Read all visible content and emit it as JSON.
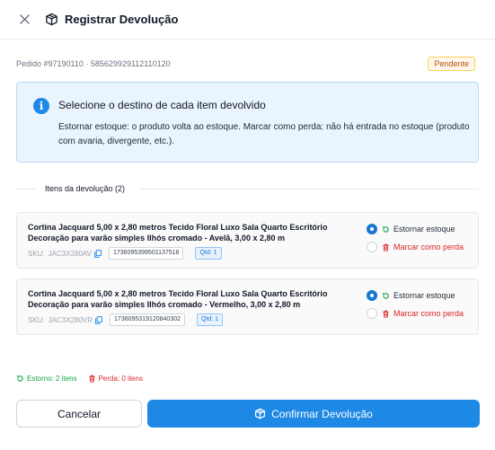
{
  "dialog": {
    "title": "Registrar Devolução",
    "order_label": "Pedido #97190110 · 585629929112110120",
    "status": "Pendente"
  },
  "info": {
    "title": "Selecione o destino de cada item devolvido",
    "text": "Estornar estoque: o produto volta ao estoque. Marcar como perda: não há entrada no estoque (produto com avaria, divergente, etc.)."
  },
  "items_section": {
    "title": "Itens da devolução (2)"
  },
  "items": [
    {
      "name": "Cortina Jacquard 5,00 x 2,80 metros Tecido Floral Luxo Sala Quarto Escritório Decoração para varão simples Ilhós cromado - Avelã, 3,00 x 2,80 m",
      "sku_label": "SKU:",
      "sku": "JAC3X280AV",
      "ean": "1736095399501137518",
      "qty": "Qtd: 1",
      "restock_label": "Estornar estoque",
      "loss_label": "Marcar como perda",
      "selected": "restock"
    },
    {
      "name": "Cortina Jacquard 5,00 x 2,80 metros Tecido Floral Luxo Sala Quarto Escritório Decoração para varão simples Ilhós cromado - Vermelho, 3,00 x 2,80 m",
      "sku_label": "SKU:",
      "sku": "JAC3X280VR",
      "ean": "1736095319120840302",
      "qty": "Qtd: 1",
      "restock_label": "Estornar estoque",
      "loss_label": "Marcar como perda",
      "selected": "restock"
    }
  ],
  "summary": {
    "restock": "Estorno: 2 itens",
    "loss": "Perda: 0 itens"
  },
  "actions": {
    "cancel": "Cancelar",
    "confirm": "Confirmar Devolução"
  },
  "icons": {
    "close": "close-icon",
    "box": "box-icon",
    "info": "info-icon",
    "copy": "copy-icon",
    "restock": "rotate-ccw-icon",
    "loss": "trash-icon"
  },
  "colors": {
    "primary": "#1e88e5",
    "success": "#16a34a",
    "danger": "#dc2626",
    "warning": "#b45309",
    "info_bg": "#eaf4fd"
  }
}
